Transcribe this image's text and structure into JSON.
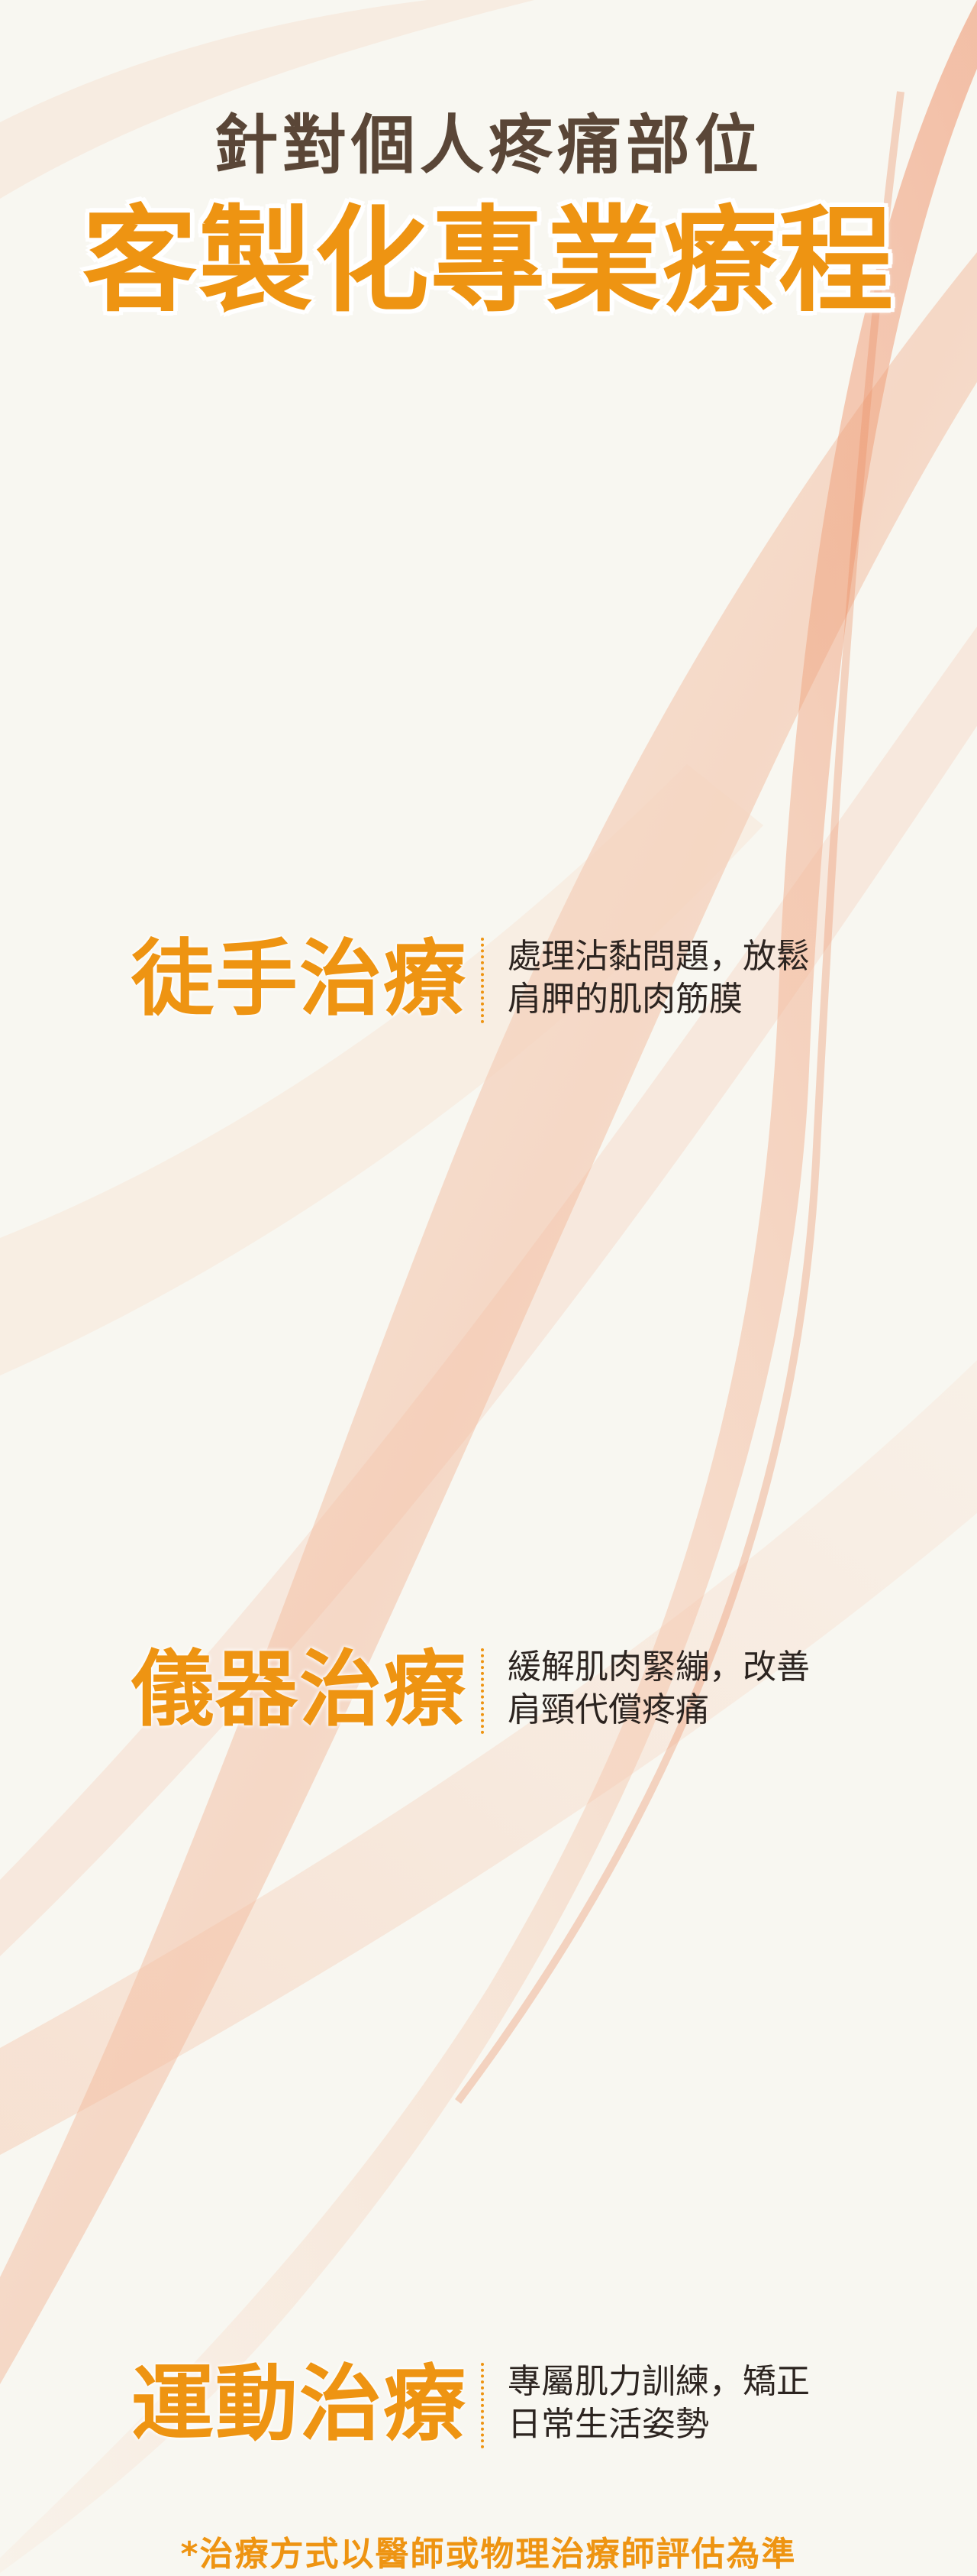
{
  "header": {
    "subtitle": "針對個人疼痛部位",
    "title": "客製化專業療程"
  },
  "treatments": [
    {
      "name": "徒手治療",
      "desc_line1": "處理沾黏問題，放鬆",
      "desc_line2": "肩胛的肌肉筋膜"
    },
    {
      "name": "儀器治療",
      "desc_line1": "緩解肌肉緊繃，改善",
      "desc_line2": "肩頸代償疼痛"
    },
    {
      "name": "運動治療",
      "desc_line1": "專屬肌力訓練，矯正",
      "desc_line2": "日常生活姿勢"
    }
  ],
  "footer": {
    "note": "*治療方式以醫師或物理治療師評估為準"
  },
  "colors": {
    "accent": "#ee9412",
    "subtitle": "#5a4637",
    "text": "#2c2420",
    "background": "#f8f7f1",
    "ribbon": "#f0a27a"
  }
}
